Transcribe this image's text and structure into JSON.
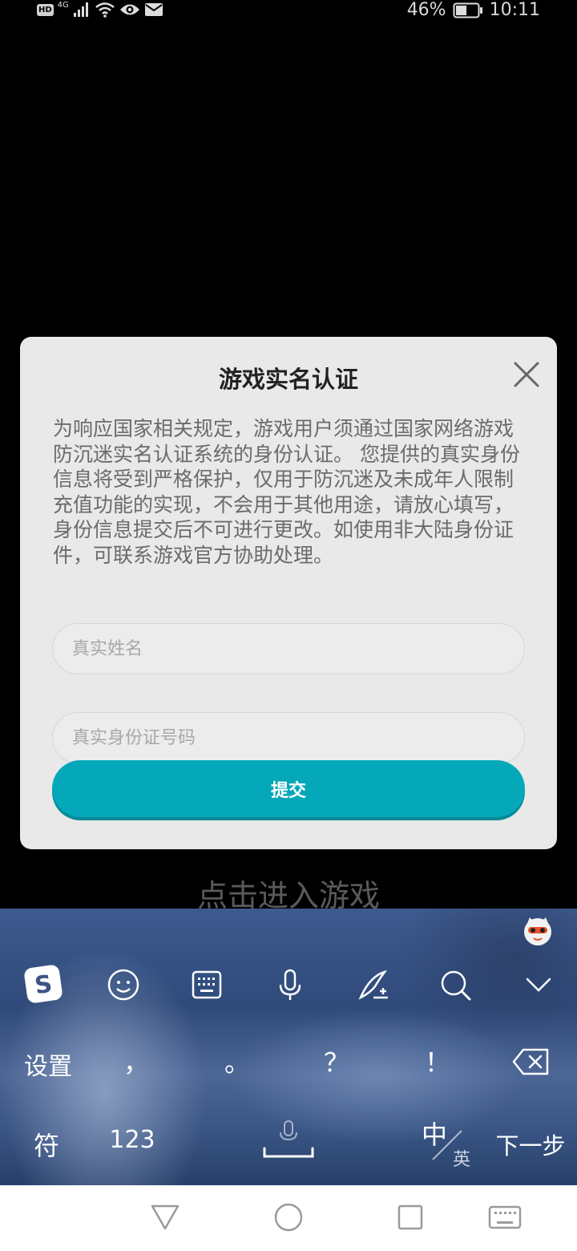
{
  "status_bar": {
    "network": "4G",
    "hd_badge": "HD",
    "battery": "46%",
    "time": "10:11"
  },
  "dialog": {
    "title": "游戏实名认证",
    "body": "为响应国家相关规定，游戏用户须通过国家网络游戏防沉迷实名认证系统的身份认证。 您提供的真实身份信息将受到严格保护，仅用于防沉迷及未成年人限制充值功能的实现，不会用于其他用途，请放心填写，身份信息提交后不可进行更改。如使用非大陆身份证件，可联系游戏官方协助处理。",
    "name_placeholder": "真实姓名",
    "id_placeholder": "真实身份证号码",
    "submit_label": "提交"
  },
  "background_text": "点击进入游戏",
  "keyboard": {
    "tools": [
      "sogou-logo-icon",
      "emoji-icon",
      "keyboard-switch-icon",
      "microphone-icon",
      "handwriting-icon",
      "search-icon",
      "collapse-icon"
    ],
    "row1": {
      "settings": "设置",
      "comma": "，",
      "period": "。",
      "question": "？",
      "exclaim": "！"
    },
    "row2": {
      "symbols": "符",
      "numbers": "123",
      "lang_primary": "中",
      "lang_secondary": "英",
      "next": "下一步"
    }
  },
  "nav_bar": {
    "icons": [
      "back-icon",
      "home-icon",
      "recents-icon",
      "keyboard-icon"
    ]
  }
}
